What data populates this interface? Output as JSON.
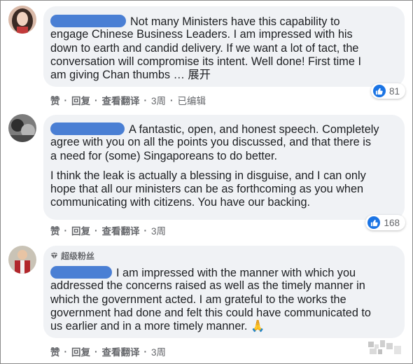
{
  "comments": [
    {
      "lines": [
        "Not many Ministers have this capability to",
        "engage Chinese Business Leaders. I am impressed with his",
        "down to earth and candid delivery. If we want a lot of tact, the",
        "conversation will compromise its intent. Well done! First time I",
        "am giving Chan thumbs …"
      ],
      "expand_label": "展开",
      "reaction_count": "81",
      "actions": {
        "like": "赞",
        "reply": "回复",
        "translate": "查看翻译",
        "time": "3周",
        "edited": "已编辑"
      }
    },
    {
      "lines": [
        "A fantastic, open, and honest speech. Completely",
        "agree with you on all the points you discussed, and that there is",
        "a need for (some) Singaporeans to do better.",
        "I think the leak is actually a blessing in disguise, and I can only",
        "hope that all our ministers can be as forthcoming as you when",
        "communicating with citizens. You have our backing."
      ],
      "reaction_count": "168",
      "actions": {
        "like": "赞",
        "reply": "回复",
        "translate": "查看翻译",
        "time": "3周"
      }
    },
    {
      "badge": "超级粉丝",
      "lines": [
        "I am impressed with the manner with which you",
        "addressed the concerns raised as well as the timely manner in",
        "which the government acted. I am grateful to the works the",
        "government had done and felt this could have communicated to",
        "us earlier and in a more timely manner."
      ],
      "emoji": "🙏",
      "actions": {
        "like": "赞",
        "reply": "回复",
        "translate": "查看翻译",
        "time": "3周"
      }
    }
  ],
  "colors": {
    "bubble": "#f0f2f5",
    "redaction": "#4a7fd4",
    "like_blue": "#1b74e4",
    "meta_text": "#65676b"
  }
}
